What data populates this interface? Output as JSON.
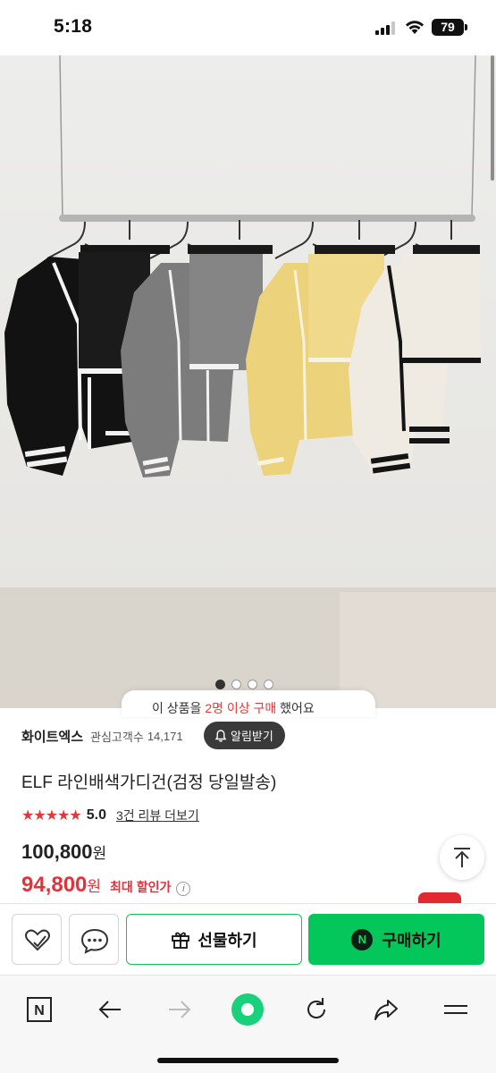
{
  "status_bar": {
    "time": "5:18",
    "battery": "79"
  },
  "gallery": {
    "current_index": 1,
    "total": 4
  },
  "purchase_tooltip": {
    "text_start": "이 상품을 ",
    "highlight": "2명 이상 구매",
    "text_end": " 했어요"
  },
  "store": {
    "name": "화이트엑스",
    "followers_label": "관심고객수",
    "followers_count": "14,171",
    "notify_label": "알림받기"
  },
  "product": {
    "title": "ELF 라인배색가디건(검정 당일발송)",
    "stars": "★★★★★",
    "rating": "5.0",
    "review_link": "3건 리뷰 더보기",
    "original_price": "100,800",
    "currency": "원",
    "sale_price": "94,800",
    "sale_label": "최대 할인가"
  },
  "actions": {
    "gift_label": "선물하기",
    "buy_label": "구매하기",
    "naver_badge": "N"
  },
  "browser_nav": {
    "home_badge": "N"
  },
  "colors": {
    "naver_green": "#03c75a",
    "sale_red": "#e2323a",
    "star_red": "#e0383b"
  }
}
